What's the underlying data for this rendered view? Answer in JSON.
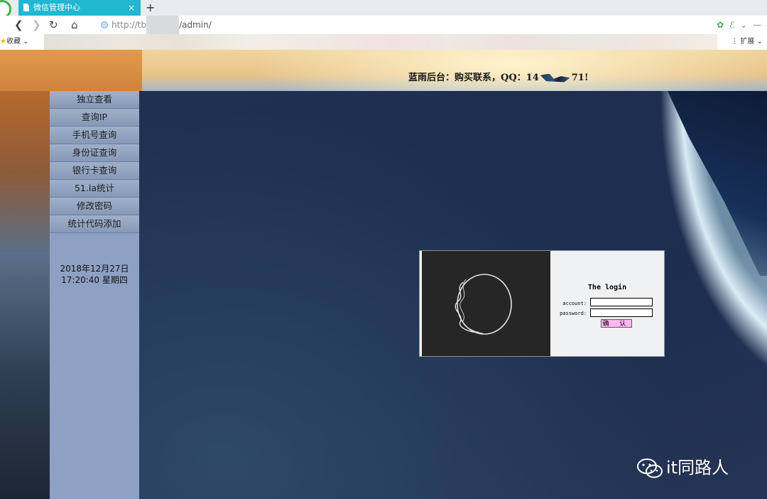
{
  "browser": {
    "tab_title": "微信管理中心",
    "tab_close": "×",
    "new_tab": "+",
    "nav_back": "❮",
    "nav_forward": "❯",
    "nav_reload": "↻",
    "nav_home": "⌂",
    "url_prefix": "http://tb",
    "url_path": "/admin/",
    "bookmark_favorites": "收藏",
    "bookmark_extensions": "扩展",
    "right_icons": [
      "✿",
      "ℰ",
      "⌄",
      "—"
    ]
  },
  "header": {
    "prefix": "蓝雨后台：购买联系，QQ：14",
    "suffix": "71!"
  },
  "sidebar": {
    "items": [
      {
        "label": "独立查看"
      },
      {
        "label": "查询IP"
      },
      {
        "label": "手机号查询"
      },
      {
        "label": "身份证查询"
      },
      {
        "label": "银行卡查询"
      },
      {
        "label": "51.la统计"
      },
      {
        "label": "修改密码"
      },
      {
        "label": "统计代码添加"
      }
    ],
    "date": "2018年12月27日",
    "time": "17:20:40 星期四"
  },
  "login": {
    "title": "The login",
    "account_label": "account:",
    "password_label": "password:",
    "account_value": "",
    "password_value": "",
    "submit_label": "确 认"
  },
  "watermark": {
    "text": "it同路人"
  },
  "colors": {
    "tab_active": "#21b7d1",
    "sidebar": "#8ea0c4",
    "submit_button": "#ffb6f1"
  }
}
